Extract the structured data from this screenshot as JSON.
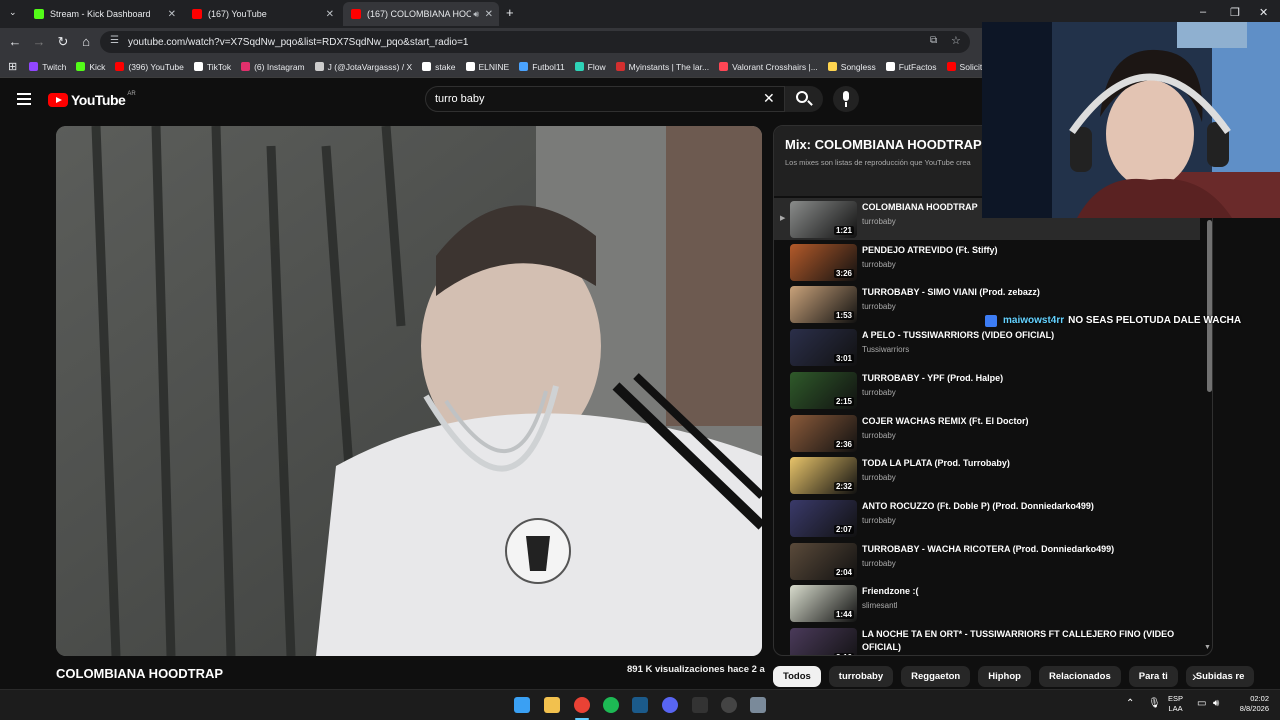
{
  "browser": {
    "tabs": [
      {
        "title": "Stream - Kick Dashboard",
        "active": false,
        "color": "#53fc18"
      },
      {
        "title": "(167) YouTube",
        "active": false,
        "color": "#ff0000"
      },
      {
        "title": "(167) COLOMBIANA HOOD",
        "active": true,
        "color": "#ff0000"
      }
    ],
    "url": "youtube.com/watch?v=X7SqdNw_pqo&list=RDX7SqdNw_pqo&start_radio=1",
    "bookmarks": [
      {
        "label": "Twitch",
        "color": "#9146ff"
      },
      {
        "label": "Kick",
        "color": "#53fc18"
      },
      {
        "label": "(396) YouTube",
        "color": "#ff0000"
      },
      {
        "label": "TikTok",
        "color": "#ffffff"
      },
      {
        "label": "(6) Instagram",
        "color": "#e1306c"
      },
      {
        "label": "J (@JotaVargasss) / X",
        "color": "#cccccc"
      },
      {
        "label": "stake",
        "color": "#ffffff"
      },
      {
        "label": "ELNINE",
        "color": "#ffffff"
      },
      {
        "label": "Futbol11",
        "color": "#4aa3ff"
      },
      {
        "label": "Flow",
        "color": "#2ed3b7"
      },
      {
        "label": "Myinstants | The lar...",
        "color": "#d32f2f"
      },
      {
        "label": "Valorant Crosshairs |...",
        "color": "#ff4655"
      },
      {
        "label": "Songless",
        "color": "#ffd54f"
      },
      {
        "label": "FutFactos",
        "color": "#ffffff"
      },
      {
        "label": "Solicitu",
        "color": "#ff0000"
      }
    ]
  },
  "youtube": {
    "logo_text": "YouTube",
    "region": "AR",
    "search_value": "turro baby",
    "video": {
      "title": "COLOMBIANA HOODTRAP",
      "views": "891 K visualizaciones  hace 2 a"
    },
    "playlist": {
      "title": "Mix: COLOMBIANA HOODTRAP",
      "subtitle": "Los mixes son listas de reproducción que YouTube crea",
      "items": [
        {
          "title": "COLOMBIANA HOODTRAP",
          "channel": "turrobaby",
          "duration": "1:21",
          "current": true,
          "thumb": "#8a8c8b"
        },
        {
          "title": "PENDEJO ATREVIDO (Ft. Stiffy)",
          "channel": "turrobaby",
          "duration": "3:26",
          "current": false,
          "thumb": "#b35a2a"
        },
        {
          "title": "TURROBABY - SIMO VIANI (Prod. zebazz)",
          "channel": "turrobaby",
          "duration": "1:53",
          "current": false,
          "thumb": "#c9a27a"
        },
        {
          "title": "A PELO - TUSSIWARRIORS (VIDEO OFICIAL)",
          "channel": "Tussiwarriors",
          "duration": "3:01",
          "current": false,
          "thumb": "#2b2f4a"
        },
        {
          "title": "TURROBABY - YPF (Prod. Halpe)",
          "channel": "turrobaby",
          "duration": "2:15",
          "current": false,
          "thumb": "#2f5a2a"
        },
        {
          "title": "COJER WACHAS REMIX (Ft. El Doctor)",
          "channel": "turrobaby",
          "duration": "2:36",
          "current": false,
          "thumb": "#8a5a3a"
        },
        {
          "title": "TODA LA PLATA (Prod. Turrobaby)",
          "channel": "turrobaby",
          "duration": "2:32",
          "current": false,
          "thumb": "#e8c46a"
        },
        {
          "title": "ANTO ROCUZZO (Ft. Doble P) (Prod. Donniedarko499)",
          "channel": "turrobaby",
          "duration": "2:07",
          "current": false,
          "thumb": "#3a3a6a"
        },
        {
          "title": "TURROBABY - WACHA RICOTERA (Prod. Donniedarko499)",
          "channel": "turrobaby",
          "duration": "2:04",
          "current": false,
          "thumb": "#5a4a3a"
        },
        {
          "title": "Friendzone :(",
          "channel": "slimesantl",
          "duration": "1:44",
          "current": false,
          "thumb": "#d8dccd"
        },
        {
          "title": "LA NOCHE TA EN ORT* - TUSSIWARRIORS FT CALLEJERO FINO (VIDEO OFICIAL)",
          "channel": "",
          "duration": "2:16",
          "current": false,
          "thumb": "#4a3a5a"
        }
      ]
    },
    "chips": [
      "Todos",
      "turrobaby",
      "Reggaeton",
      "Hiphop",
      "Relacionados",
      "Para ti",
      "Subidas re"
    ]
  },
  "chat": {
    "username": "maiwowst4rr",
    "message": "NO SEAS PELOTUDA DALE WACHA"
  },
  "taskbar": {
    "icons": [
      {
        "name": "windows-start-icon",
        "color": "#3aa0f3"
      },
      {
        "name": "file-explorer-icon",
        "color": "#f2c14e"
      },
      {
        "name": "chrome-icon",
        "color": "#e94235"
      },
      {
        "name": "spotify-icon",
        "color": "#1db954"
      },
      {
        "name": "steam-icon",
        "color": "#1b5a8a"
      },
      {
        "name": "discord-icon",
        "color": "#5865f2"
      },
      {
        "name": "epic-games-icon",
        "color": "#333333"
      },
      {
        "name": "obs-icon",
        "color": "#444444"
      },
      {
        "name": "settings-icon",
        "color": "#7a8a9a"
      }
    ],
    "lang_line1": "ESP",
    "lang_line2": "LAA",
    "time": "02:02",
    "date": "8/8/2026"
  }
}
